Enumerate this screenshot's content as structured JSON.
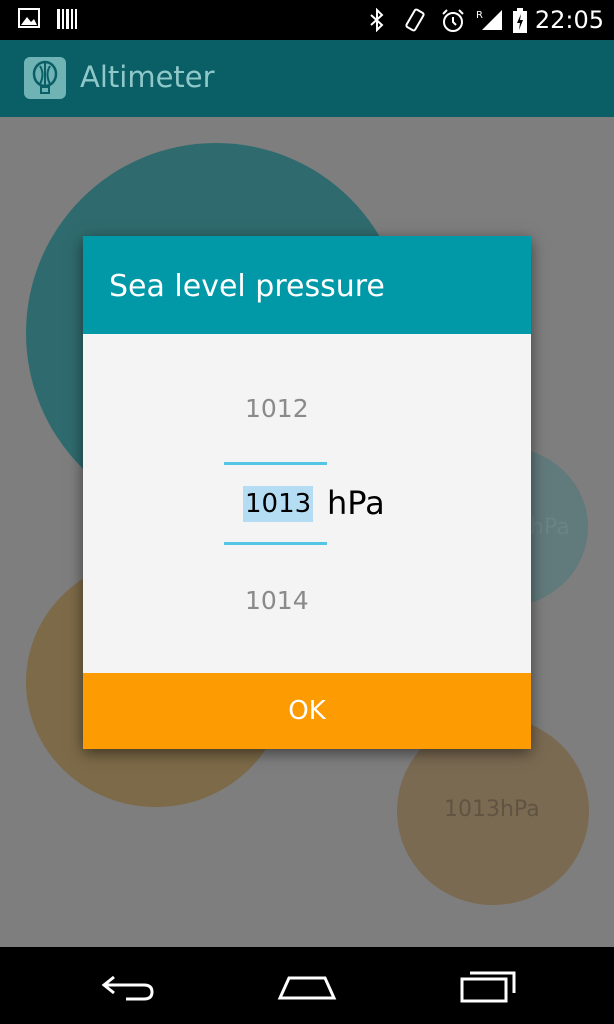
{
  "status_bar": {
    "time": "22:05",
    "icons": [
      "gallery-icon",
      "barcode-icon",
      "bluetooth-icon",
      "vibrate-icon",
      "alarm-icon",
      "signal-icon",
      "battery-charging-icon"
    ]
  },
  "app_bar": {
    "title": "Altimeter",
    "logo_icon": "balloon-icon"
  },
  "background": {
    "circle_labels": [
      "hPa",
      "1013hPa"
    ]
  },
  "dialog": {
    "title": "Sea level pressure",
    "picker": {
      "previous": "1012",
      "current": "1013",
      "next": "1014",
      "unit": "hPa"
    },
    "ok_label": "OK"
  },
  "nav_bar": {
    "buttons": [
      "back-icon",
      "home-icon",
      "recents-icon"
    ]
  },
  "colors": {
    "app_bar": "#0a5e66",
    "dialog_header": "#0199a8",
    "ok_button": "#fd9b03",
    "picker_divider": "#55c5e6",
    "selection_highlight": "#b4dcf2"
  }
}
